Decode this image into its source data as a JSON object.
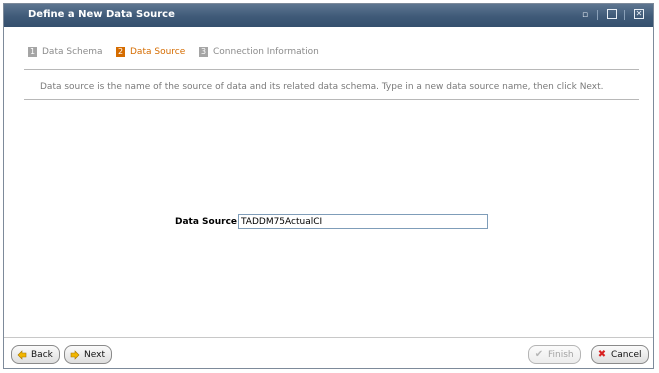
{
  "window": {
    "title": "Define a New Data Source"
  },
  "controls": {
    "minimize": "▭",
    "restore": "▢",
    "close": "✕"
  },
  "steps": [
    {
      "num": "1",
      "label": "Data Schema",
      "active": false
    },
    {
      "num": "2",
      "label": "Data Source",
      "active": true
    },
    {
      "num": "3",
      "label": "Connection Information",
      "active": false
    }
  ],
  "description": "Data source is the name of the source of data and its related data schema. Type in a new data source name, then click Next.",
  "form": {
    "data_source_label": "Data Source:",
    "data_source_value": "TADDM75ActualCI"
  },
  "buttons": {
    "back": "Back",
    "next": "Next",
    "finish": "Finish",
    "cancel": "Cancel"
  },
  "colors": {
    "active_step": "#d56c00",
    "titlebar": "#3f5a78"
  }
}
